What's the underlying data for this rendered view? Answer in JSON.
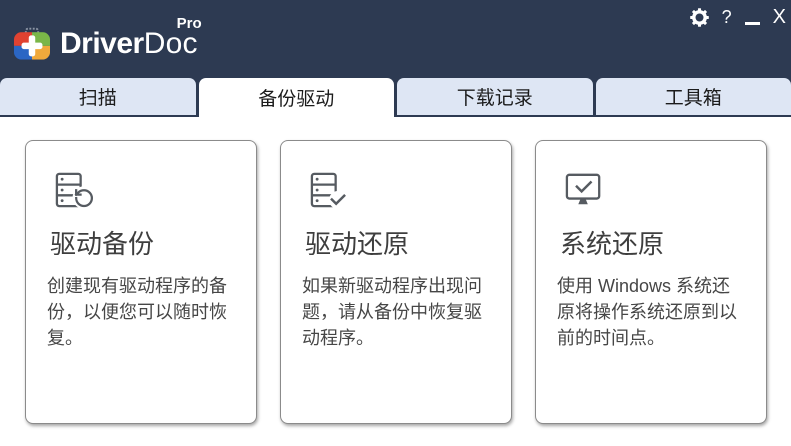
{
  "app": {
    "name": "DriverDoc Pro"
  },
  "brand": {
    "driver": "Driver",
    "doc": "Doc",
    "pro": "Pro"
  },
  "window_controls": {
    "settings_icon": "gear",
    "help": "?",
    "minimize": "_",
    "close": "X"
  },
  "tabs": [
    {
      "label": "扫描",
      "active": false
    },
    {
      "label": "备份驱动",
      "active": true
    },
    {
      "label": "下载记录",
      "active": false
    },
    {
      "label": "工具箱",
      "active": false
    }
  ],
  "cards": [
    {
      "icon": "server-backup-icon",
      "title": "驱动备份",
      "description": "创建现有驱动程序的备份，以便您可以随时恢复。"
    },
    {
      "icon": "server-restore-check-icon",
      "title": "驱动还原",
      "description": "如果新驱动程序出现问题，请从备份中恢复驱动程序。"
    },
    {
      "icon": "monitor-check-icon",
      "title": "系统还原",
      "description": "使用 Windows 系统还原将操作系统还原到以前的时间点。"
    }
  ],
  "colors": {
    "header_bg": "#2d3a52",
    "tab_inactive_bg": "#dee6f4",
    "tab_active_bg": "#ffffff",
    "card_border": "#8b8b8b",
    "icon_color": "#565b61",
    "logo_red": "#e04231",
    "logo_green": "#7ab648",
    "logo_blue": "#2b66c4",
    "logo_orange": "#f0a93c"
  }
}
